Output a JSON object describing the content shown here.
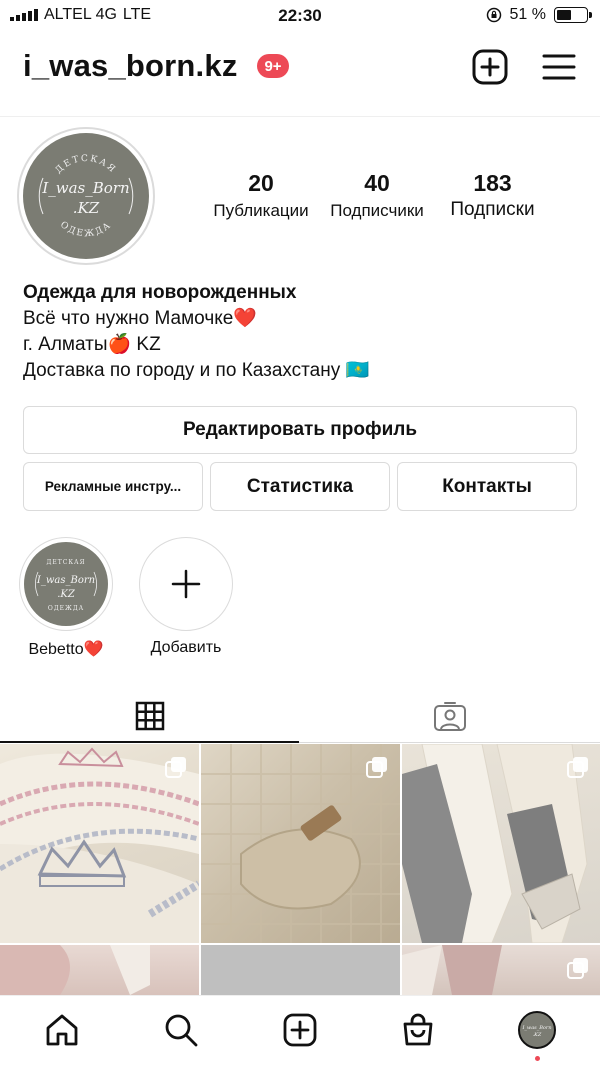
{
  "status_bar": {
    "carrier": "ALTEL 4G",
    "network": "LTE",
    "time": "22:30",
    "battery_percent": "51 %",
    "battery_level": 0.51
  },
  "header": {
    "username": "i_was_born.kz",
    "notification_badge": "9+"
  },
  "profile": {
    "avatar_logo": {
      "top_text": "ДЕТСКАЯ",
      "main_text": "I_was_Born",
      "sub_text": ".KZ",
      "bottom_text": "ОДЕЖДА"
    },
    "stats": [
      {
        "value": "20",
        "label": "Публикации"
      },
      {
        "value": "40",
        "label": "Подписчики"
      },
      {
        "value": "183",
        "label": "Подписки"
      }
    ],
    "bio": {
      "name": "Одежда для новорожденных",
      "line1": "Всё что нужно Мамочке❤️",
      "line2": "г. Алматы🍎 KZ",
      "line3": "Доставка по городу и по Казахстану 🇰🇿"
    }
  },
  "buttons": {
    "edit_profile": "Редактировать профиль",
    "ads_tools": "Рекламные инстру...",
    "statistics": "Статистика",
    "contacts": "Контакты"
  },
  "highlights": [
    {
      "label": "Bebetto❤️"
    },
    {
      "label": "Добавить"
    }
  ],
  "colors": {
    "badge": "#ed4956",
    "logo_bg": "#7b7c73",
    "border": "#dbdbdb"
  },
  "icons": {
    "header": [
      "new-post-icon",
      "menu-icon"
    ],
    "tabs": [
      "grid-icon",
      "tagged-icon"
    ],
    "bottom_nav": [
      "home-icon",
      "search-icon",
      "create-icon",
      "shop-icon",
      "profile-avatar"
    ]
  }
}
